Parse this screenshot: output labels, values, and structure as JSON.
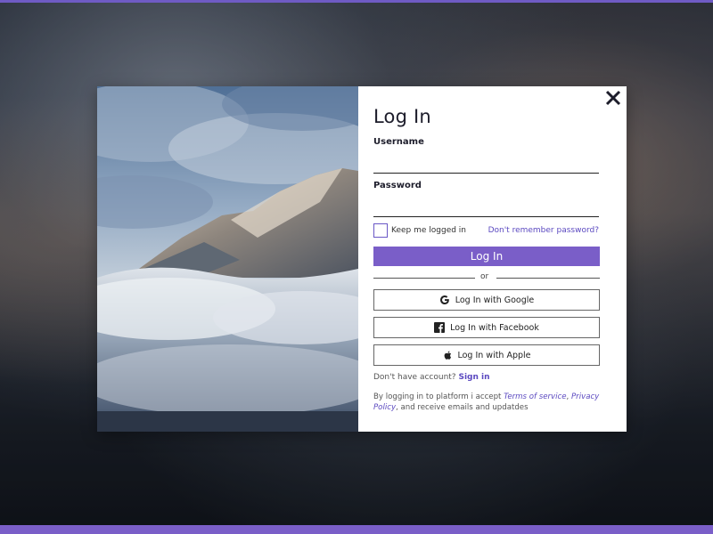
{
  "accent_color": "#7a5ec8",
  "link_color": "#5b49c0",
  "close_icon": "close-icon",
  "form": {
    "title": "Log In",
    "username_label": "Username",
    "username_value": "",
    "password_label": "Password",
    "password_value": "",
    "keep_logged_in_label": "Keep me logged in",
    "keep_logged_in_checked": false,
    "forgot_password_link": "Don't remember password?",
    "login_button": "Log In",
    "divider_text": "or"
  },
  "social": [
    {
      "label": "Log In with Google",
      "icon": "google-icon"
    },
    {
      "label": "Log In with Facebook",
      "icon": "facebook-icon"
    },
    {
      "label": "Log In with Apple",
      "icon": "apple-icon"
    }
  ],
  "signup": {
    "prompt": "Don't have account?",
    "link": "Sign in"
  },
  "legal": {
    "prefix": "By logging in to platform i accept ",
    "terms_link": "Terms of service",
    "separator": ", ",
    "privacy_link": "Privacy Policy",
    "suffix": ", and receive emails and updatdes"
  }
}
